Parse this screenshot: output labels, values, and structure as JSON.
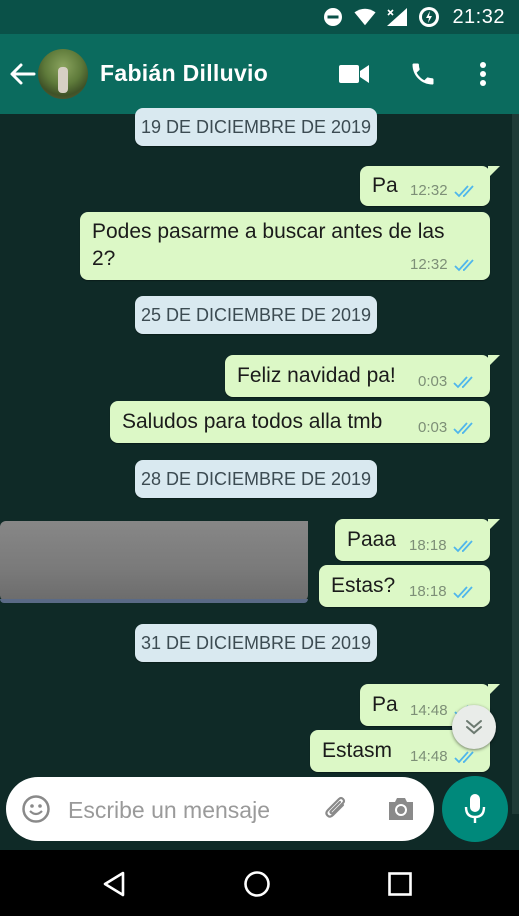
{
  "status_bar": {
    "time": "21:32",
    "icons": [
      "do-not-disturb-icon",
      "wifi-icon",
      "cell-signal-icon",
      "battery-charging-icon"
    ]
  },
  "header": {
    "contact_name": "Fabián Dilluvio",
    "icons": [
      "back-arrow-icon",
      "avatar",
      "video-call-icon",
      "phone-icon",
      "more-vert-icon"
    ]
  },
  "chat": {
    "dates": [
      "19 DE DICIEMBRE DE 2019",
      "25 DE DICIEMBRE DE 2019",
      "28 DE DICIEMBRE DE 2019",
      "31 DE DICIEMBRE DE 2019"
    ],
    "messages": [
      {
        "text": "Pa",
        "time": "12:32",
        "status": "read"
      },
      {
        "text_line1": "Podes pasarme a buscar antes de las",
        "text_line2": "2?",
        "time": "12:32",
        "status": "read"
      },
      {
        "text": "Feliz navidad pa!",
        "time": "0:03",
        "status": "read"
      },
      {
        "text": "Saludos para todos alla tmb",
        "time": "0:03",
        "status": "read"
      },
      {
        "text": "Paaa",
        "time": "18:18",
        "status": "read"
      },
      {
        "text": "Estas?",
        "time": "18:18",
        "status": "read"
      },
      {
        "text": "Pa",
        "time": "14:48",
        "status": "read"
      },
      {
        "text": "Estasm",
        "time": "14:48",
        "status": "read"
      }
    ]
  },
  "input": {
    "placeholder": "Escribe un mensaje"
  },
  "colors": {
    "header": "#0b6b5e",
    "status_bar": "#0a5148",
    "chat_bg": "#0f2a27",
    "outgoing_bubble": "#dcf8c6",
    "date_pill": "#d9e9f0",
    "read_ticks": "#4fb6ec",
    "mic_button": "#00897b"
  }
}
